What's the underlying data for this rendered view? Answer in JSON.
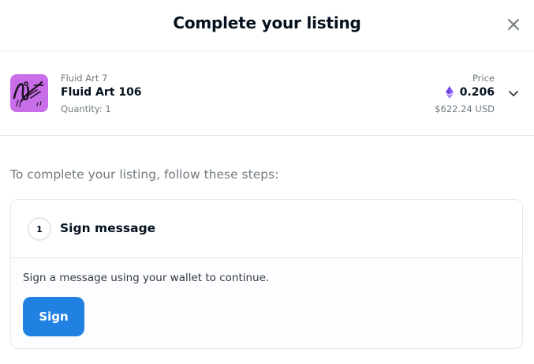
{
  "header": {
    "title": "Complete your listing",
    "close_icon": "close-icon"
  },
  "item": {
    "collection": "Fluid Art 7",
    "name": "Fluid Art 106",
    "quantity": "Quantity: 1",
    "price_label": "Price",
    "price_eth": "0.206",
    "price_usd": "$622.24 USD",
    "currency_icon": "ethereum-icon",
    "expand_icon": "chevron-down-icon",
    "thumbnail_color": "#c86ee8"
  },
  "steps": {
    "intro": "To complete your listing, follow these steps:",
    "items": [
      {
        "number": "1",
        "title": "Sign message",
        "description": "Sign a message using your wallet to continue.",
        "button_label": "Sign"
      }
    ]
  },
  "colors": {
    "accent": "#2081e2",
    "ethereum": "#8a5cf6",
    "border": "#e5e8eb",
    "text_primary": "#04111d",
    "text_secondary": "#70797f"
  }
}
